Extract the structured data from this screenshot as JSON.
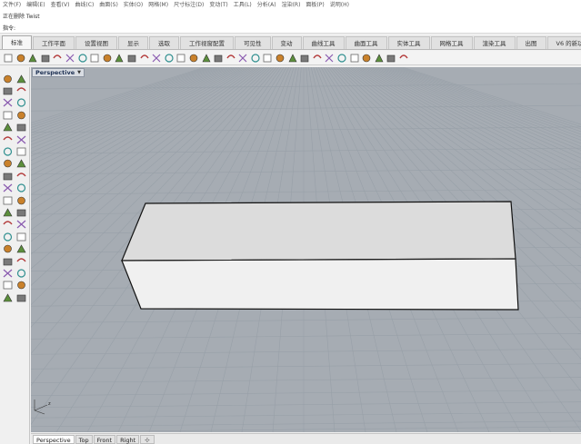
{
  "menu": [
    "文件(F)",
    "编辑(E)",
    "查看(V)",
    "曲线(C)",
    "曲面(S)",
    "实体(O)",
    "网格(M)",
    "尺寸标注(D)",
    "变动(T)",
    "工具(L)",
    "分析(A)",
    "渲染(R)",
    "面板(P)",
    "说明(H)"
  ],
  "command_history": {
    "faded_line": "",
    "status_line": "正在删除 Twist"
  },
  "command_prompt": "指令:",
  "ribbon_tabs": [
    {
      "label": "标准",
      "active": true
    },
    {
      "label": "工作平面"
    },
    {
      "label": "设置视图"
    },
    {
      "label": "显示"
    },
    {
      "label": "选取"
    },
    {
      "label": "工作视窗配置"
    },
    {
      "label": "可见性"
    },
    {
      "label": "变动"
    },
    {
      "label": "曲线工具"
    },
    {
      "label": "曲面工具"
    },
    {
      "label": "实体工具"
    },
    {
      "label": "网格工具"
    },
    {
      "label": "渲染工具"
    },
    {
      "label": "出图"
    },
    {
      "label": "V6 的新功能"
    }
  ],
  "toolbar_icons": [
    "new-file-icon",
    "open-file-icon",
    "save-icon",
    "print-icon",
    "import-icon",
    "cut-icon",
    "copy-icon",
    "paste-icon",
    "undo-icon",
    "pan-icon",
    "rotate-view-icon",
    "zoom-icon",
    "zoom-window-icon",
    "zoom-extents-icon",
    "zoom-selected-icon",
    "rotate-icon",
    "grid-icon",
    "hide-icon",
    "lock-icon",
    "layer-icon",
    "object-properties-icon",
    "light-icon",
    "shade-icon",
    "render-icon",
    "material-icon",
    "sphere-icon",
    "sphere-shaded-icon",
    "environment-icon",
    "brush-icon",
    "options-icon",
    "network-icon",
    "plugin-icon",
    "help-icon"
  ],
  "sidebar_icons": [
    [
      "select-arrow-icon",
      "point-icon"
    ],
    [
      "polyline-icon",
      "curve-from-points-icon"
    ],
    [
      "circle-icon",
      "ellipse-icon"
    ],
    [
      "arc-icon",
      "rectangle-icon"
    ],
    [
      "polygon-icon",
      "fillet-curve-icon"
    ],
    [
      "offset-curve-icon",
      "curve-tools-icon"
    ],
    [
      "surface-from-curves-icon",
      "extrude-curve-icon"
    ],
    [
      "loft-icon",
      "surface-tools-icon"
    ],
    [
      "box-icon",
      "cylinder-icon"
    ],
    [
      "sphere-solid-icon",
      "solid-tools-icon"
    ],
    [
      "extrude-surface-icon",
      "boolean-union-icon"
    ],
    [
      "mesh-icon",
      "mesh-tools-icon"
    ],
    [
      "render-tools-icon",
      "dimension-icon"
    ],
    [
      "trim-icon",
      "split-icon"
    ],
    [
      "join-icon",
      "explode-icon"
    ],
    [
      "move-icon",
      "copy-object-icon"
    ],
    [
      "array-icon",
      "scale-icon"
    ],
    [
      "analyze-icon",
      "check-icon"
    ],
    [
      "group-icon",
      "layer-tools-icon"
    ]
  ],
  "viewport": {
    "title": "Perspective",
    "background": "#a6acb3",
    "grid_color": "#98a0a8",
    "box_top_color": "#dcdcdc",
    "box_front_color": "#f0f0f0",
    "axis_label": "z"
  },
  "view_tabs": [
    {
      "label": "Perspective",
      "active": true
    },
    {
      "label": "Top"
    },
    {
      "label": "Front"
    },
    {
      "label": "Right"
    },
    {
      "label": "✣",
      "add": true
    }
  ]
}
